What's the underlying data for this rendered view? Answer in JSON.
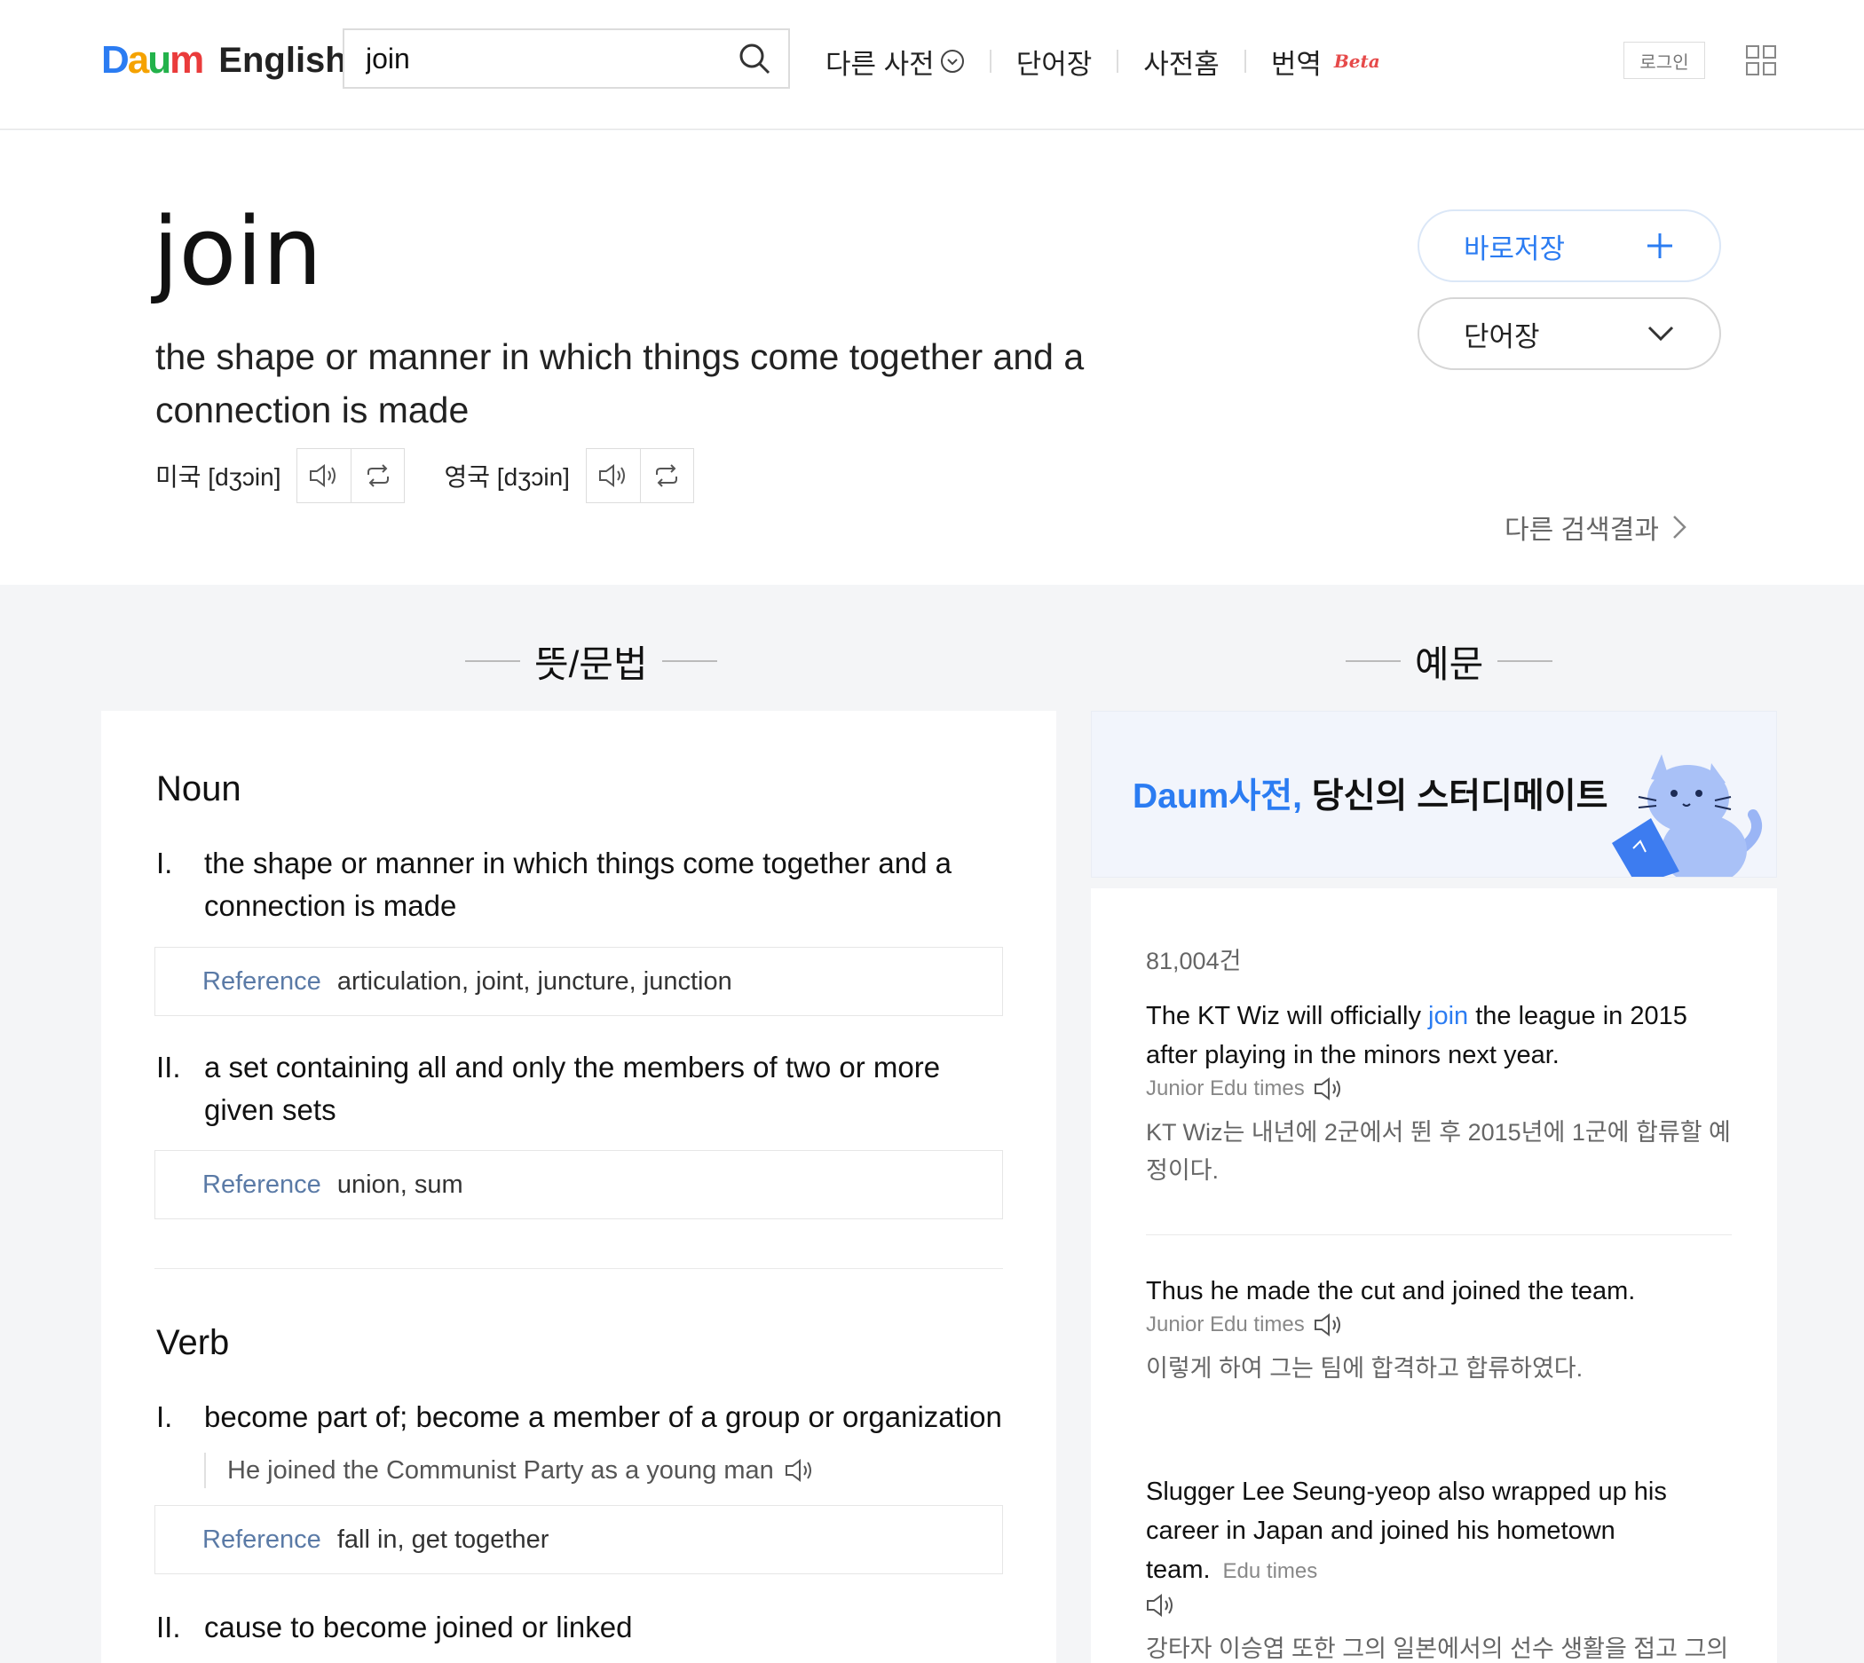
{
  "header": {
    "logo_daum": "Daum",
    "logo_english": "English",
    "search_value": "join",
    "search_placeholder": "",
    "nav": {
      "other_dict": "다른 사전",
      "wordbook": "단어장",
      "dict_home": "사전홈",
      "translate": "번역",
      "beta": "Beta"
    },
    "login": "로그인"
  },
  "word": {
    "title": "join",
    "meaning": "the shape or manner in which things come together and a connection is made",
    "pron_us_label": "미국 [dʒɔin]",
    "pron_uk_label": "영국 [dʒɔin]",
    "save_label": "바로저장",
    "wordbook_label": "단어장",
    "other_results": "다른 검색결과"
  },
  "sections": {
    "meaning_heading": "뜻/문법",
    "example_heading": "예문"
  },
  "definitions": {
    "noun_label": "Noun",
    "noun": [
      {
        "num": "I.",
        "text": "the shape or manner in which things come together and a connection is made",
        "ref_label": "Reference",
        "ref": "articulation, joint, juncture, junction"
      },
      {
        "num": "II.",
        "text": "a set containing all and only the members of two or more given sets",
        "ref_label": "Reference",
        "ref": "union, sum"
      }
    ],
    "verb_label": "Verb",
    "verb": [
      {
        "num": "I.",
        "text": "become part of; become a member of a group or organization",
        "example": "He joined the Communist Party as a young man",
        "ref_label": "Reference",
        "ref": "fall in, get together"
      },
      {
        "num": "II.",
        "text": "cause to become joined or linked"
      }
    ]
  },
  "banner": {
    "brand": "Daum사전,",
    "tagline": " 당신의 스터디메이트"
  },
  "examples": {
    "count": "81,004건",
    "items": [
      {
        "en_pre": "The KT Wiz will officially ",
        "en_hl": "join",
        "en_post": " the league in 2015 after playing in the minors next year.",
        "source": "Junior Edu times",
        "ko": "KT Wiz는 내년에 2군에서 뛴 후 2015년에 1군에 합류할 예정이다."
      },
      {
        "en": "Thus he made the cut and joined the team.",
        "source": "Junior Edu times",
        "ko": "이렇게 하여 그는 팀에 합격하고 합류하였다."
      },
      {
        "en": "Slugger Lee Seung-yeop also wrapped up his career in Japan and joined his hometown team.",
        "source": "Edu times",
        "ko": "강타자 이승엽 또한 그의 일본에서의 선수 생활을 접고 그의 고향팀에 합류하였다."
      }
    ]
  },
  "colors": {
    "accent": "#2b7cf2",
    "beta": "#e64a4a",
    "reference": "#5a7aa6"
  }
}
